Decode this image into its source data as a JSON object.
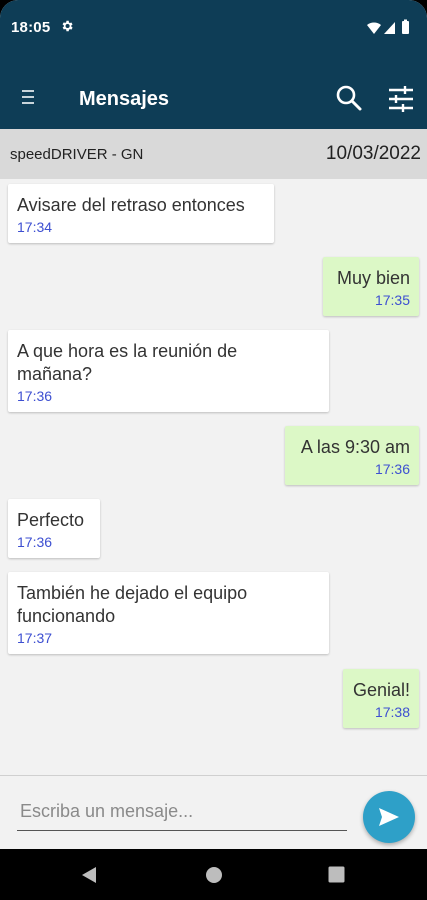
{
  "status_bar": {
    "time": "18:05",
    "icons": [
      "settings-icon",
      "wifi-icon",
      "signal-icon",
      "battery-icon"
    ]
  },
  "app_bar": {
    "title": "Mensajes",
    "icons": [
      "menu-icon",
      "search-icon",
      "filter-icon"
    ]
  },
  "conversation": {
    "contact": "speedDRIVER - GN",
    "date": "10/03/2022"
  },
  "messages": [
    {
      "direction": "in",
      "text": "Avisare del retraso entonces",
      "time": "17:34"
    },
    {
      "direction": "out",
      "text": "Muy bien",
      "time": "17:35"
    },
    {
      "direction": "in",
      "text": "A que hora es la reunión de\nmañana?",
      "time": "17:36"
    },
    {
      "direction": "out",
      "text": "A las 9:30 am",
      "time": "17:36"
    },
    {
      "direction": "in",
      "text": "Perfecto",
      "time": "17:36"
    },
    {
      "direction": "in",
      "text": "También he dejado el equipo\nfuncionando",
      "time": "17:37"
    },
    {
      "direction": "out",
      "text": "Genial!",
      "time": "17:38"
    }
  ],
  "composer": {
    "placeholder": "Escriba un mensaje..."
  },
  "colors": {
    "primary": "#0e3d56",
    "incoming_bubble": "#ffffff",
    "outgoing_bubble": "#dcf8c6",
    "timestamp": "#3d4fd1",
    "send_button": "#2ea0c8"
  }
}
